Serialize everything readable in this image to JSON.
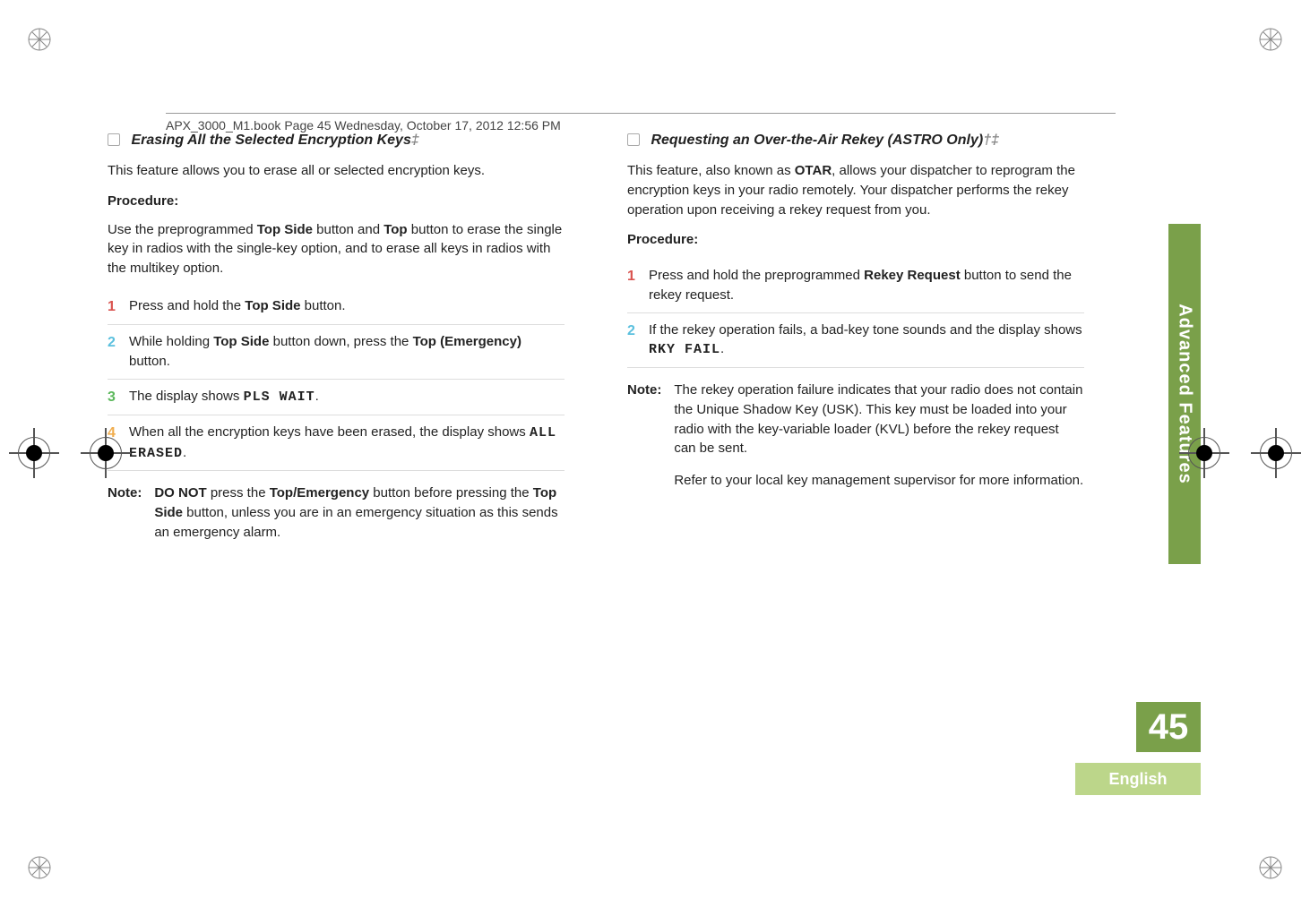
{
  "header": "APX_3000_M1.book  Page 45  Wednesday, October 17, 2012  12:56 PM",
  "side_tab": "Advanced Features",
  "page_number": "45",
  "language": "English",
  "left": {
    "title": "Erasing All the Selected Encryption Keys",
    "title_suffix": "‡",
    "intro": "This feature allows you to erase all or selected encryption keys.",
    "proc_label": "Procedure:",
    "proc_desc_1": "Use the preprogrammed ",
    "proc_desc_b1": "Top Side",
    "proc_desc_2": " button and ",
    "proc_desc_b2": "Top",
    "proc_desc_3": " button to erase the single key in radios with the single-key option, and to erase all keys in radios with the multikey option.",
    "steps": [
      {
        "n": "1",
        "pre": "Press and hold the ",
        "b1": "Top Side",
        "post": " button."
      },
      {
        "n": "2",
        "pre": "While holding ",
        "b1": "Top Side",
        "mid": " button down, press the ",
        "b2": "Top (Emergency)",
        "post": " button."
      },
      {
        "n": "3",
        "pre": "The display shows ",
        "lcd": "PLS WAIT",
        "post": "."
      },
      {
        "n": "4",
        "pre": "When all the encryption keys have been erased, the display shows ",
        "lcd": "ALL ERASED",
        "post": "."
      }
    ],
    "note_label": "Note:",
    "note_b1": "DO NOT",
    "note_t1": " press the ",
    "note_b2": "Top/Emergency",
    "note_t2": " button before pressing the ",
    "note_b3": "Top Side",
    "note_t3": " button, unless you are in an emergency situation as this sends an emergency alarm."
  },
  "right": {
    "title": "Requesting an Over-the-Air Rekey (ASTRO Only)",
    "title_suffix": "†‡",
    "intro_1": "This feature, also known as ",
    "intro_b": "OTAR",
    "intro_2": ", allows your dispatcher to reprogram the encryption keys in your radio remotely. Your dispatcher performs the rekey operation upon receiving a rekey request from you.",
    "proc_label": "Procedure:",
    "steps": [
      {
        "n": "1",
        "pre": "Press and hold the preprogrammed ",
        "b1": "Rekey Request",
        "post": " button to send the rekey request."
      },
      {
        "n": "2",
        "pre": "If the rekey operation fails, a bad-key tone sounds and the display shows ",
        "lcd": "RKY FAIL",
        "post": "."
      }
    ],
    "note_label": "Note:",
    "note_p1": "The rekey operation failure indicates that your radio does not contain the Unique Shadow Key (USK). This key must be loaded into your radio with the key-variable loader (KVL) before the rekey request can be sent.",
    "note_p2": "Refer to your local key management supervisor for more information."
  }
}
